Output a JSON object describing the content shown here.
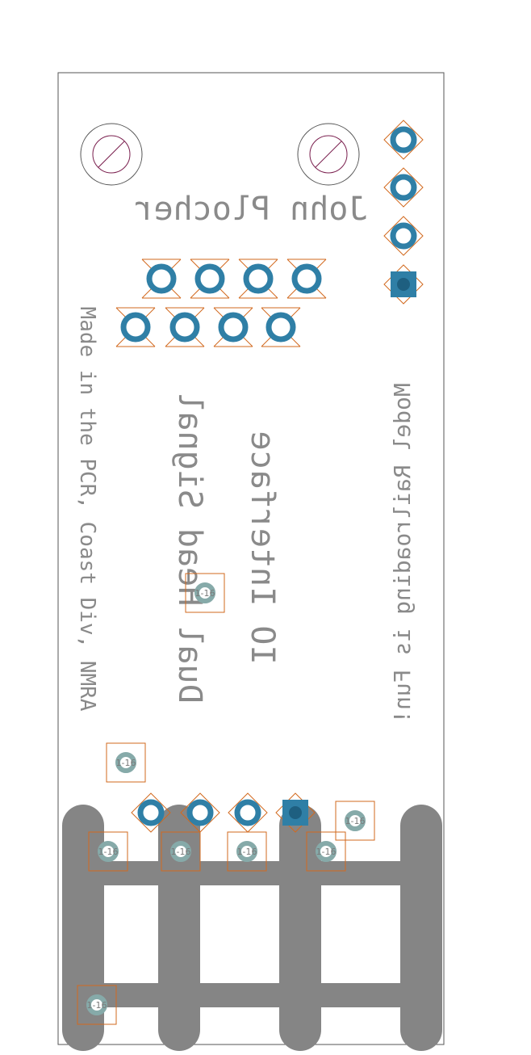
{
  "board": {
    "credit": "John Plocher",
    "title_line1": "Dual Head Signal",
    "title_line2": "IO Interface",
    "left_note": "Made in the PCR, Coast Div, NMRA",
    "right_note": "Model Railroading is Fun!",
    "via_label": "1-16"
  },
  "colors": {
    "outline": "#555555",
    "copper_pad": "#2f7fa6",
    "via": "#86aaa9",
    "outline_orange": "#d2691e",
    "trace": "#858585",
    "silk": "#8a8a8a",
    "mount_hole": "#7a1f4e"
  }
}
